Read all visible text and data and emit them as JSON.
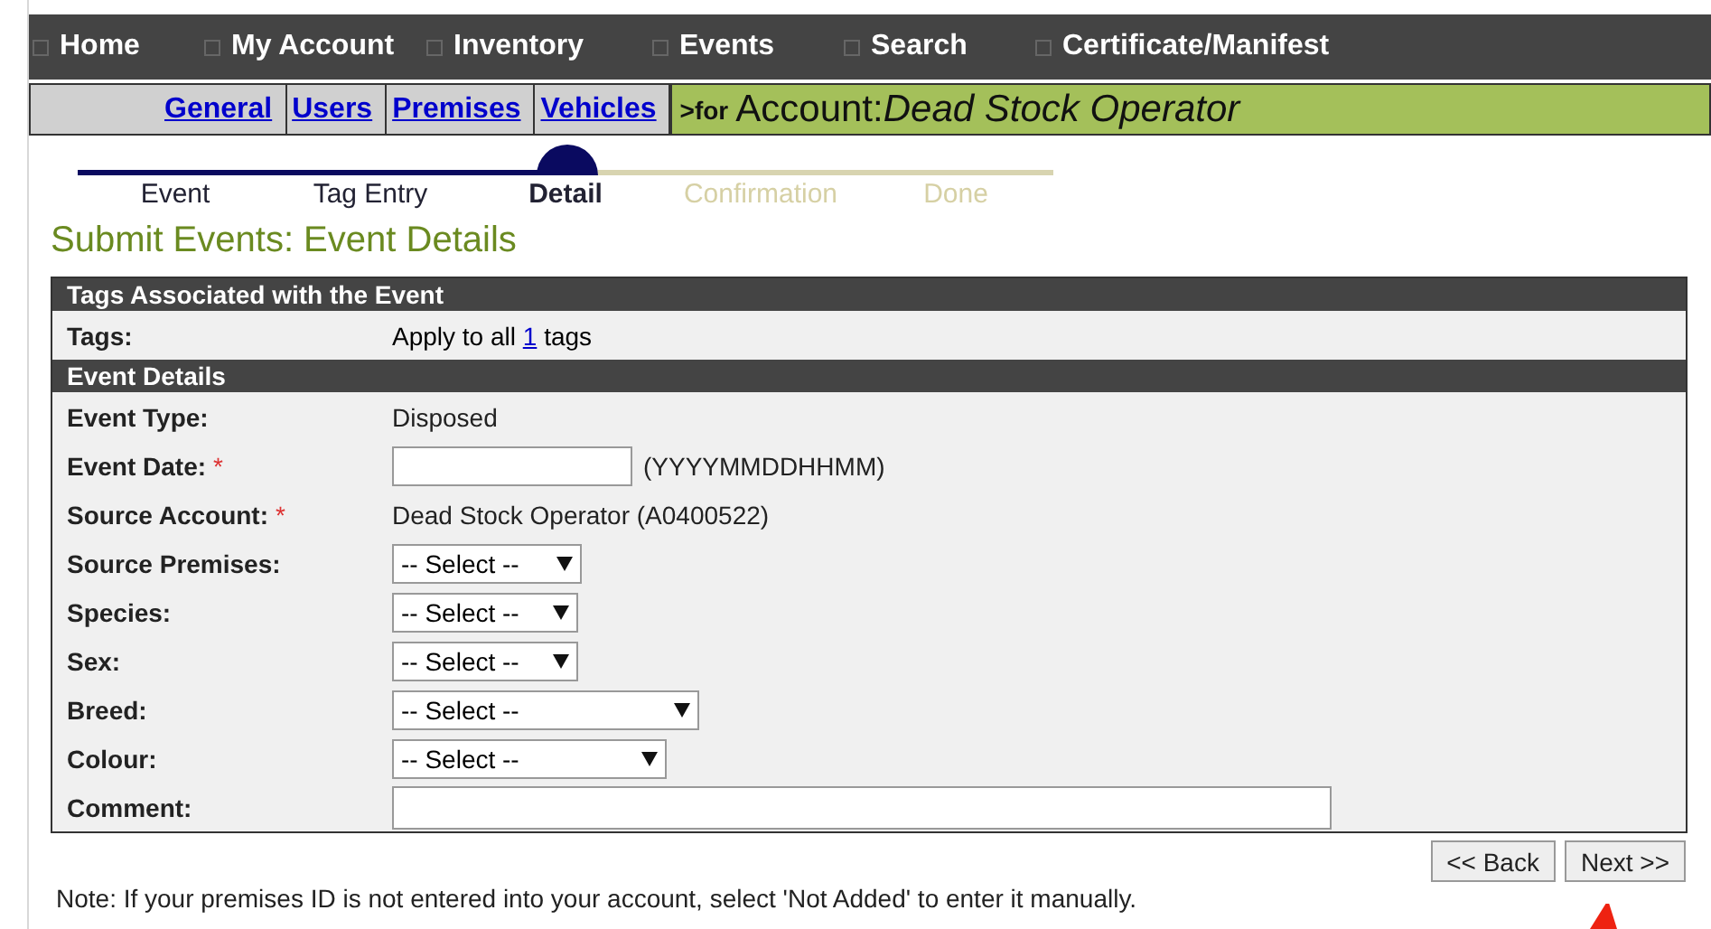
{
  "nav": [
    {
      "label": "Home"
    },
    {
      "label": "My Account"
    },
    {
      "label": "Inventory"
    },
    {
      "label": "Events"
    },
    {
      "label": "Search"
    },
    {
      "label": "Certificate/Manifest"
    }
  ],
  "subnav": [
    {
      "label": "General"
    },
    {
      "label": "Users"
    },
    {
      "label": "Premises"
    },
    {
      "label": "Vehicles"
    }
  ],
  "account_banner": {
    "prefix": ">for",
    "label": "Account:",
    "name": "Dead Stock Operator"
  },
  "steps": [
    {
      "label": "Event",
      "completed": true,
      "selected": false
    },
    {
      "label": "Tag Entry",
      "completed": true,
      "selected": false
    },
    {
      "label": "Detail",
      "completed": false,
      "selected": true
    },
    {
      "label": "Confirmation",
      "completed": false,
      "selected": false
    },
    {
      "label": "Done",
      "completed": false,
      "selected": false
    }
  ],
  "title": "Submit Events: Event Details",
  "sections": [
    {
      "heading": "Tags Associated with the Event",
      "rows": [
        {
          "kind": "tags",
          "label": "Tags:",
          "before": "Apply to all",
          "link": "1",
          "after": "tags"
        }
      ]
    },
    {
      "heading": "Event Details",
      "rows": [
        {
          "kind": "text",
          "label": "Event Type:",
          "value": "Disposed"
        },
        {
          "kind": "input",
          "label": "Event Date:",
          "required_mark": "*",
          "hint": "(YYYYMMDDHHMM)"
        },
        {
          "kind": "text",
          "label": "Source Account:",
          "required_mark": "*",
          "value": "Dead Stock Operator (A0400522)"
        },
        {
          "kind": "select",
          "label": "Source Premises:",
          "value": "-- Select --"
        },
        {
          "kind": "select",
          "label": "Species:",
          "value": "-- Select --"
        },
        {
          "kind": "select",
          "label": "Sex:",
          "value": "-- Select --"
        },
        {
          "kind": "select",
          "label": "Breed:",
          "value": "-- Select --"
        },
        {
          "kind": "select",
          "label": "Colour:",
          "value": "-- Select --"
        },
        {
          "kind": "comment",
          "label": "Comment:"
        }
      ]
    }
  ],
  "buttons": [
    {
      "label": "<< Back"
    },
    {
      "label": "Next >>"
    }
  ],
  "note": "Note: If your premises ID is not entered into your account, select 'Not Added' to enter it manually."
}
